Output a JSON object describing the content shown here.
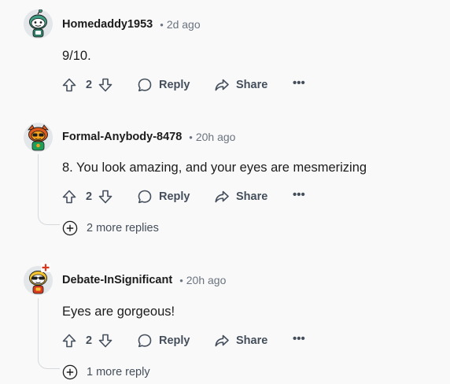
{
  "comments": [
    {
      "username": "Homedaddy1953",
      "separator": "•",
      "time": "2d ago",
      "body": "9/10.",
      "votes": "2",
      "reply_label": "Reply",
      "share_label": "Share",
      "more_label": "•••",
      "avatar_colors": {
        "bg": "#e4e7ea",
        "head": "#3e9e84",
        "face": "#ffffff",
        "accent": "#2f7d66"
      }
    },
    {
      "username": "Formal-Anybody-8478",
      "separator": "•",
      "time": "20h ago",
      "body": "8. You look amazing, and your eyes are mesmerizing",
      "votes": "2",
      "reply_label": "Reply",
      "share_label": "Share",
      "more_label": "•••",
      "more_replies": "2 more replies",
      "avatar_colors": {
        "bg": "#e4e7ea",
        "head": "#e05a1c",
        "face": "#ffffff",
        "accent": "#1f9e5a"
      }
    },
    {
      "username": "Debate-InSignificant",
      "separator": "•",
      "time": "20h ago",
      "body": "Eyes are gorgeous!",
      "votes": "2",
      "reply_label": "Reply",
      "share_label": "Share",
      "more_label": "•••",
      "more_replies": "1 more reply",
      "avatar_colors": {
        "bg": "#e4e7ea",
        "head": "#f3c331",
        "face": "#ffffff",
        "accent": "#d93a1f",
        "badge": "#d93a1f"
      }
    }
  ],
  "icons": {
    "upvote": "upvote-icon",
    "downvote": "downvote-icon",
    "reply": "comment-bubble-icon",
    "share": "share-arrow-icon",
    "more": "overflow-dots-icon",
    "expand": "circle-plus-icon"
  }
}
